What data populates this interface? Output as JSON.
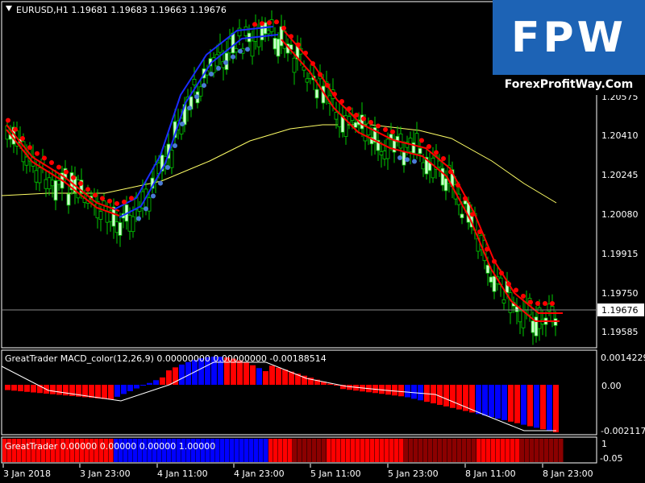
{
  "window": {
    "symbol_label": "EURUSD,H1  1.19681 1.19683 1.19663 1.19676"
  },
  "logo": {
    "letters": "FPW",
    "domain": "ForexProfitWay.Com"
  },
  "main_chart": {
    "price_ticks": [
      "1.20575",
      "1.20410",
      "1.20245",
      "1.20080",
      "1.19915",
      "1.19750",
      "1.19585"
    ],
    "current_price": "1.19676",
    "colors": {
      "bull": "#ccffcc",
      "bear": "#00cc00",
      "red_band": "#ff0000",
      "blue_band": "#1a2cff",
      "ma": "#ffff66",
      "dot_red": "#ff0000",
      "dot_blue": "#4a7bd6"
    }
  },
  "macd_panel": {
    "title": "GreatTrader MACD_color(12,26,9) 0.00000000 0.00000000 -0.00188514",
    "ticks": [
      "0.0014229",
      "0.00",
      "-0.002117"
    ]
  },
  "strip_panel": {
    "title": "GreatTrader 0.00000 0.00000 0.00000 1.00000",
    "ticks": [
      "1",
      "-0.05"
    ]
  },
  "time_axis": [
    "3 Jan 2018",
    "3 Jan 23:00",
    "4 Jan 11:00",
    "4 Jan 23:00",
    "5 Jan 11:00",
    "5 Jan 23:00",
    "8 Jan 11:00",
    "8 Jan 23:00"
  ]
}
